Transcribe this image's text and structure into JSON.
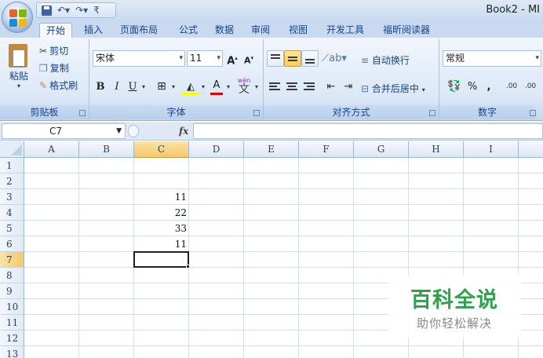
{
  "app": {
    "window_title": "Book2 - MI"
  },
  "ribbon_tabs": [
    "开始",
    "插入",
    "页面布局",
    "公式",
    "数据",
    "审阅",
    "视图",
    "开发工具",
    "福昕阅读器"
  ],
  "clipboard": {
    "paste": "粘贴",
    "cut": "剪切",
    "copy": "复制",
    "format_painter": "格式刷",
    "group_label": "剪贴板"
  },
  "font": {
    "name": "宋体",
    "size": "11",
    "bold": "B",
    "italic": "I",
    "underline": "U",
    "font_color_glyph": "A",
    "phonetic_glyph": "wén",
    "group_label": "字体"
  },
  "alignment": {
    "wrap_text": "自动换行",
    "merge_center": "合并后居中",
    "group_label": "对齐方式"
  },
  "number": {
    "format": "常规",
    "percent": "%",
    "comma": ",",
    "inc_decimal": ".00",
    "dec_decimal": ".00",
    "group_label": "数字"
  },
  "formula_bar": {
    "name_box": "C7",
    "fx": "fx",
    "value": ""
  },
  "sheet": {
    "columns": [
      "A",
      "B",
      "C",
      "D",
      "E",
      "F",
      "G",
      "H",
      "I"
    ],
    "rows": [
      "1",
      "2",
      "3",
      "4",
      "5",
      "6",
      "7",
      "8",
      "9",
      "10",
      "11",
      "12",
      "13"
    ],
    "selected_column": "C",
    "selected_row": "7",
    "cells": [
      {
        "ref": "C3",
        "value": "11"
      },
      {
        "ref": "C4",
        "value": "22"
      },
      {
        "ref": "C5",
        "value": "33"
      },
      {
        "ref": "C6",
        "value": "11"
      }
    ]
  },
  "watermark": {
    "main": "百科全说",
    "sub": "助你轻松解决"
  },
  "colors": {
    "ribbon_text": "#15428b",
    "selected_header": "#f6c868",
    "watermark_green": "#2aa34a"
  }
}
